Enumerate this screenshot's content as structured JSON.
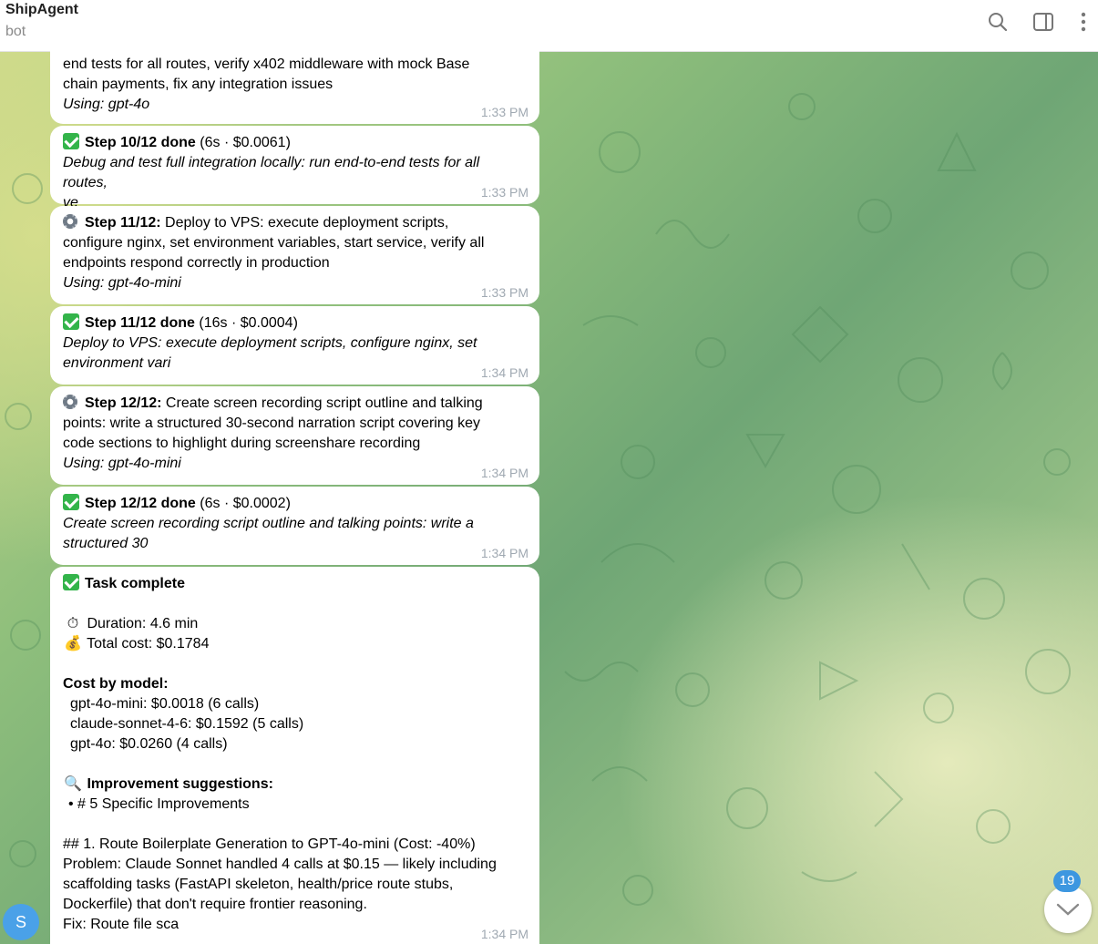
{
  "header": {
    "title": "ShipAgent",
    "subtitle": "bot",
    "icons": [
      "search-icon",
      "sidebar-toggle-icon",
      "more-vertical-icon"
    ]
  },
  "messages": [
    {
      "lines": [
        "end tests for all routes, verify x402 middleware with mock Base",
        "chain payments, fix any integration issues"
      ],
      "using": "Using: gpt-4o",
      "time": "1:33 PM"
    },
    {
      "status": "done",
      "step": "Step 10/12 done",
      "meta": "(6s · $0.0061)",
      "desc": [
        "Debug and test full integration locally: run end-to-end tests for all routes,",
        "ve"
      ],
      "time": "1:33 PM"
    },
    {
      "status": "running",
      "step": "Step 11/12:",
      "rest": " Deploy to VPS: execute deployment scripts,",
      "lines": [
        "configure nginx, set environment variables, start service, verify all",
        "endpoints respond correctly in production"
      ],
      "using": "Using: gpt-4o-mini",
      "time": "1:33 PM"
    },
    {
      "status": "done",
      "step": "Step 11/12 done",
      "meta": "(16s · $0.0004)",
      "desc": [
        "Deploy to VPS: execute deployment scripts, configure nginx, set",
        "environment vari"
      ],
      "time": "1:34 PM"
    },
    {
      "status": "running",
      "step": "Step 12/12:",
      "rest": " Create screen recording script outline and talking",
      "lines": [
        "points: write a structured 30-second narration script covering key",
        "code sections to highlight during screenshare recording"
      ],
      "using": "Using: gpt-4o-mini",
      "time": "1:34 PM"
    },
    {
      "status": "done",
      "step": "Step 12/12 done",
      "meta": "(6s · $0.0002)",
      "desc": [
        "Create screen recording script outline and talking points: write a",
        "structured 30"
      ],
      "time": "1:34 PM"
    }
  ],
  "summary": {
    "title": "Task complete",
    "duration": "Duration: 4.6 min",
    "cost": "Total cost: $0.1784",
    "cost_by_model_label": "Cost by model:",
    "models": [
      "gpt-4o-mini: $0.0018 (6 calls)",
      "claude-sonnet-4-6: $0.1592 (5 calls)",
      "gpt-4o: $0.0260 (4 calls)"
    ],
    "improvement_label": "Improvement suggestions:",
    "bullet": "• # 5 Specific Improvements",
    "body": [
      "## 1. Route Boilerplate Generation to GPT-4o-mini (Cost: -40%)",
      "Problem: Claude Sonnet handled 4 calls at $0.15 — likely including",
      "scaffolding tasks (FastAPI skeleton, health/price route stubs,",
      "Dockerfile) that don't require frontier reasoning.",
      "Fix: Route file sca"
    ],
    "time": "1:34 PM"
  },
  "avatar_letter": "S",
  "unread_count": "19",
  "colors": {
    "check": "#33b44a",
    "accent": "#3d97e0",
    "time": "#a0a9b2"
  }
}
